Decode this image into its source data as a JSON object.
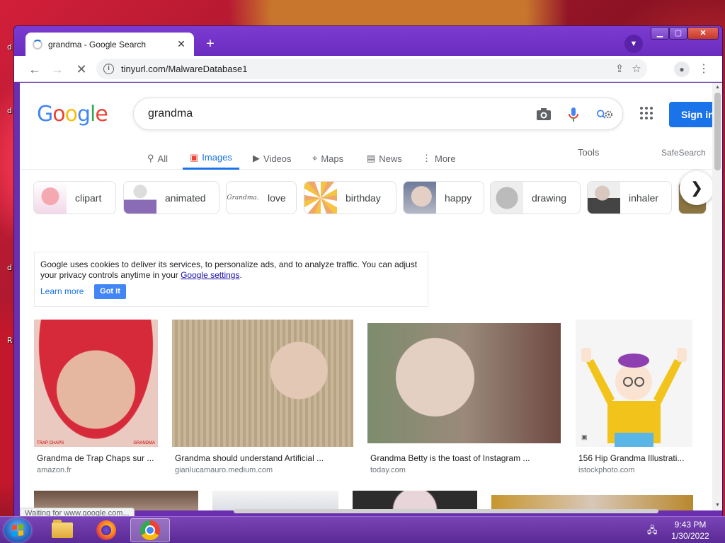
{
  "browser": {
    "tab_title": "grandma - Google Search",
    "tab_close": "✕",
    "new_tab": "+",
    "url": "tinyurl.com/MalwareDatabase1",
    "status_text": "Waiting for www.google.com..."
  },
  "window_controls": {
    "minimize": "▁",
    "maximize": "▢",
    "close": "✕"
  },
  "google": {
    "logo_letters": [
      "G",
      "o",
      "o",
      "g",
      "l",
      "e"
    ],
    "query": "grandma",
    "sign_in": "Sign in",
    "tabs": [
      {
        "label": "All",
        "icon": "search-icon",
        "glyph": "⚲"
      },
      {
        "label": "Images",
        "icon": "image-icon",
        "glyph": "▣"
      },
      {
        "label": "Videos",
        "icon": "video-icon",
        "glyph": "▶"
      },
      {
        "label": "Maps",
        "icon": "map-pin-icon",
        "glyph": "⌖"
      },
      {
        "label": "News",
        "icon": "news-icon",
        "glyph": "▤"
      },
      {
        "label": "More",
        "icon": "more-vert-icon",
        "glyph": "⋮"
      }
    ],
    "tools": "Tools",
    "safesearch": "SafeSearch",
    "chips": [
      "clipart",
      "animated",
      "love",
      "birthday",
      "happy",
      "drawing",
      "inhaler"
    ],
    "chip_love_thumb_text": "Grandma.",
    "cookie": {
      "text_before": "Google uses cookies to deliver its services, to personalize ads, and to analyze traffic. You can adjust your privacy controls anytime in your ",
      "link": "Google settings",
      "text_after": ".",
      "learn_more": "Learn more",
      "got_it": "Got it"
    },
    "results": [
      {
        "title": "Grandma de Trap Chaps sur ...",
        "source": "amazon.fr",
        "img_caption_left": "TRAP CHAPS",
        "img_caption_right": "GRANDMA"
      },
      {
        "title": "Grandma should understand Artificial ...",
        "source": "gianlucamauro.medium.com"
      },
      {
        "title": "Grandma Betty is the toast of Instagram ...",
        "source": "today.com"
      },
      {
        "title": "156 Hip Grandma Illustrati...",
        "source": "istockphoto.com"
      }
    ]
  },
  "taskbar": {
    "time": "9:43 PM",
    "date": "1/30/2022"
  },
  "colors": {
    "window_frame": "#6a2fb0",
    "google_blue": "#1a73e8",
    "link": "#1a0dab"
  }
}
